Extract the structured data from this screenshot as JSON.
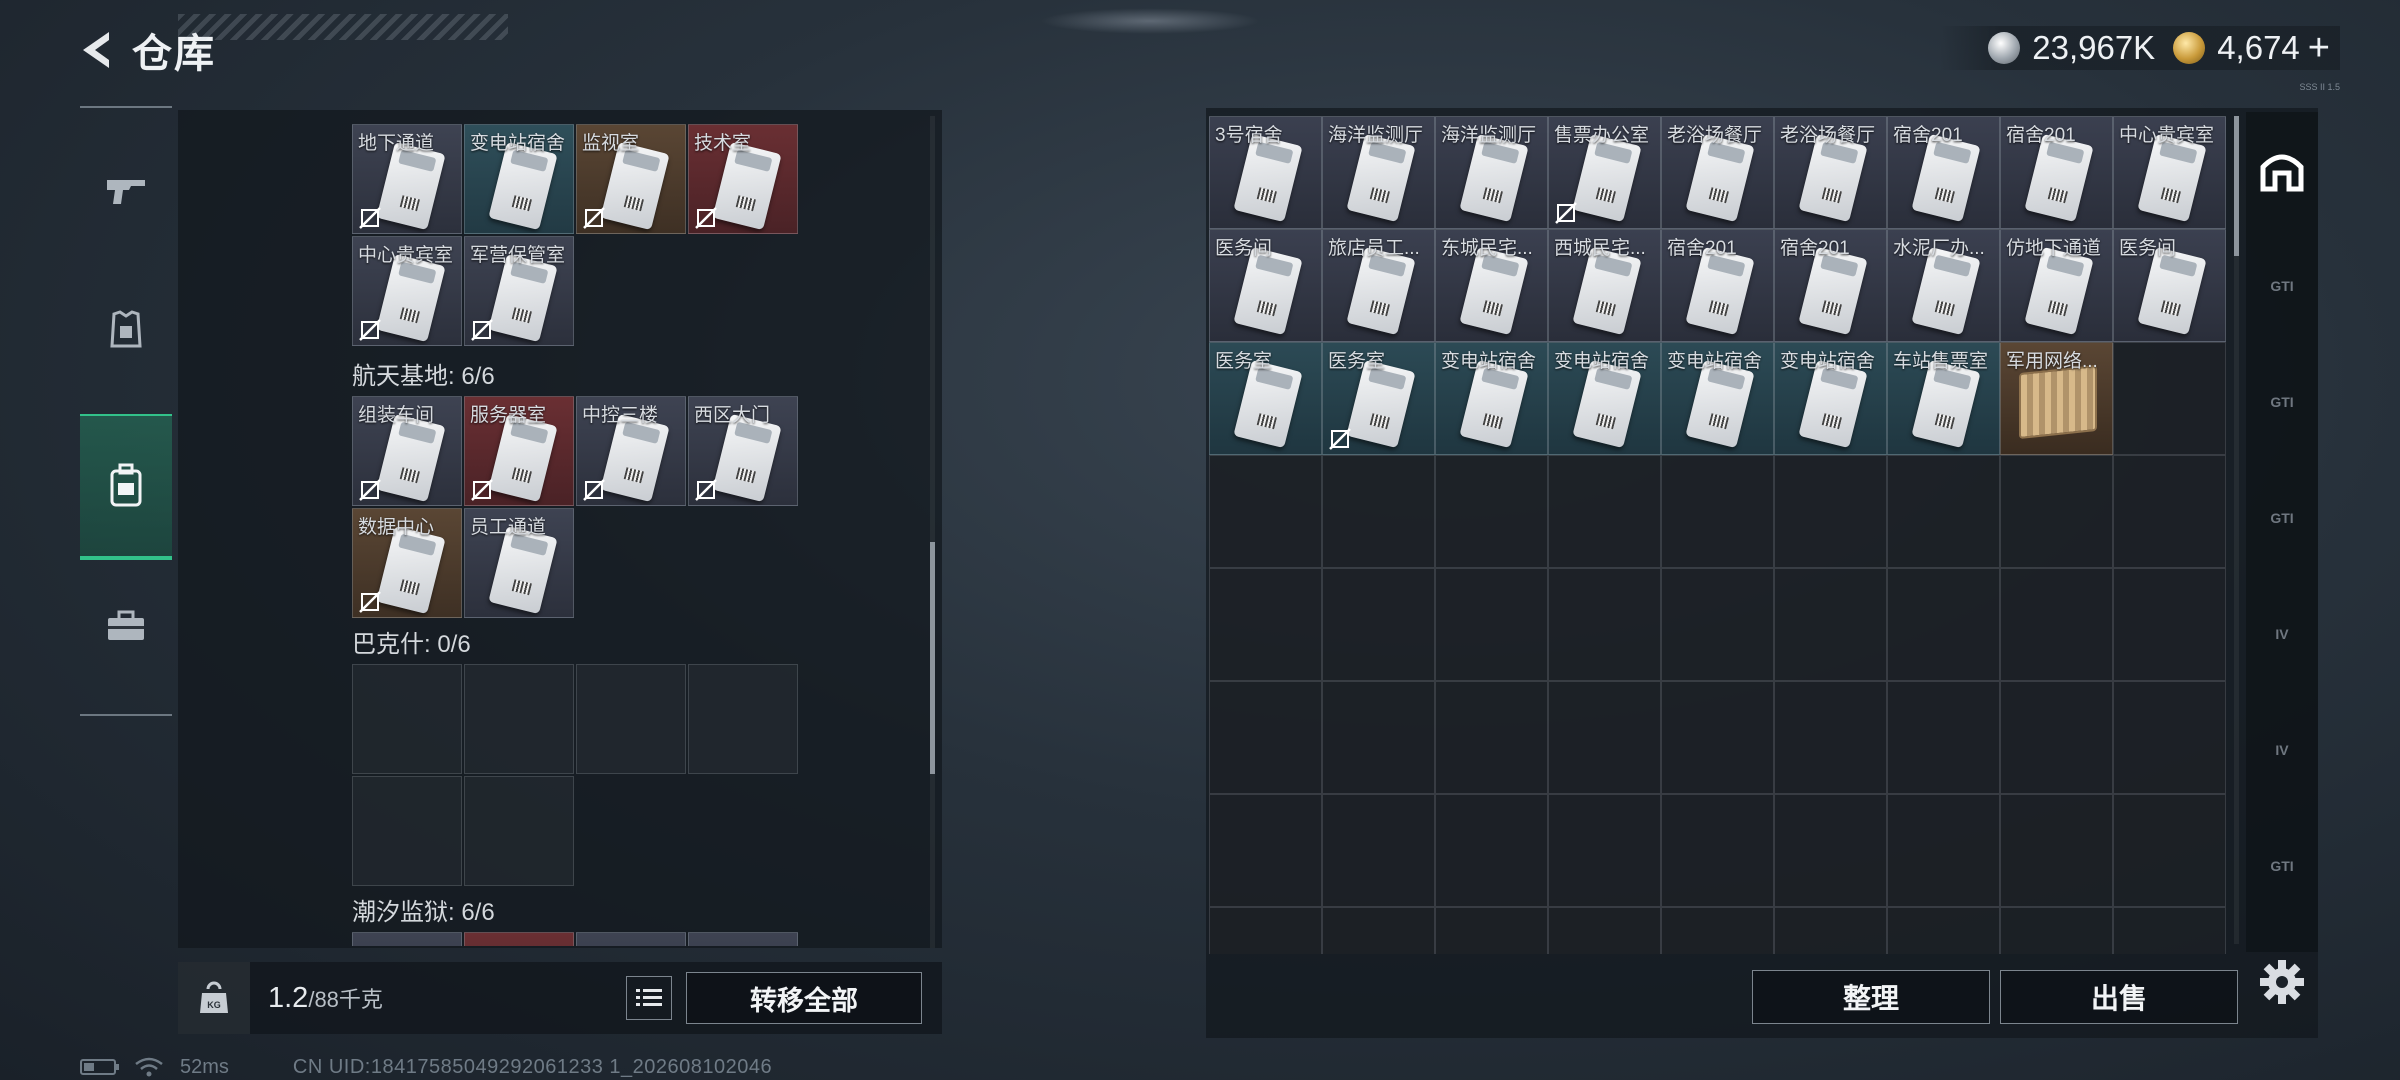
{
  "header": {
    "title": "仓库"
  },
  "currency": {
    "silver": "23,967K",
    "gold": "4,674",
    "plus": "+"
  },
  "tiny_tag": "SSS II 1.5",
  "sidebar": {
    "items": [
      "gun-icon",
      "armor-icon",
      "backpack-icon",
      "toolbox-icon"
    ],
    "active_index": 2
  },
  "left": {
    "groups": [
      {
        "label": "",
        "cells": [
          {
            "name": "地下通道",
            "color": "gray",
            "bound": true
          },
          {
            "name": "变电站宿舍",
            "color": "teal",
            "bound": false
          },
          {
            "name": "监视室",
            "color": "brown",
            "bound": true
          },
          {
            "name": "技术室",
            "color": "red",
            "bound": true
          },
          {
            "name": "中心贵宾室",
            "color": "gray",
            "bound": true
          },
          {
            "name": "军营保管室",
            "color": "gray",
            "bound": true
          }
        ]
      },
      {
        "label": "航天基地: 6/6",
        "cells": [
          {
            "name": "组装车间",
            "color": "gray",
            "bound": true
          },
          {
            "name": "服务器室",
            "color": "red",
            "bound": true
          },
          {
            "name": "中控三楼",
            "color": "gray",
            "bound": true
          },
          {
            "name": "西区大门",
            "color": "gray",
            "bound": true
          },
          {
            "name": "数据中心",
            "color": "brown",
            "bound": true
          },
          {
            "name": "员工通道",
            "color": "gray",
            "bound": false
          }
        ]
      },
      {
        "label": "巴克什: 0/6",
        "cells": []
      },
      {
        "label": "潮汐监狱: 6/6",
        "cells": []
      }
    ],
    "weight_current": "1.2",
    "weight_max": "/88千克",
    "transfer_all": "转移全部"
  },
  "right": {
    "items": [
      {
        "name": "3号宿舍",
        "color": "gray",
        "bound": false,
        "kind": "card"
      },
      {
        "name": "海洋监测厅",
        "color": "gray",
        "bound": false,
        "kind": "card"
      },
      {
        "name": "海洋监测厅",
        "color": "gray",
        "bound": false,
        "kind": "card"
      },
      {
        "name": "售票办公室",
        "color": "gray",
        "bound": true,
        "kind": "card"
      },
      {
        "name": "老浴场餐厅",
        "color": "gray",
        "bound": false,
        "kind": "card"
      },
      {
        "name": "老浴场餐厅",
        "color": "gray",
        "bound": false,
        "kind": "card"
      },
      {
        "name": "宿舍201",
        "color": "gray",
        "bound": false,
        "kind": "card"
      },
      {
        "name": "宿舍201",
        "color": "gray",
        "bound": false,
        "kind": "card"
      },
      {
        "name": "中心贵宾室",
        "color": "gray",
        "bound": false,
        "kind": "card"
      },
      {
        "name": "医务间",
        "color": "gray",
        "bound": false,
        "kind": "card"
      },
      {
        "name": "旅店员工...",
        "color": "gray",
        "bound": false,
        "kind": "card"
      },
      {
        "name": "东城民宅...",
        "color": "gray",
        "bound": false,
        "kind": "card"
      },
      {
        "name": "西城民宅...",
        "color": "gray",
        "bound": false,
        "kind": "card"
      },
      {
        "name": "宿舍201",
        "color": "gray",
        "bound": false,
        "kind": "card"
      },
      {
        "name": "宿舍201",
        "color": "gray",
        "bound": false,
        "kind": "card"
      },
      {
        "name": "水泥厂办...",
        "color": "gray",
        "bound": false,
        "kind": "card"
      },
      {
        "name": "仿地下通道",
        "color": "gray",
        "bound": false,
        "kind": "card"
      },
      {
        "name": "医务间",
        "color": "gray",
        "bound": false,
        "kind": "card"
      },
      {
        "name": "医务室",
        "color": "teal",
        "bound": false,
        "kind": "card"
      },
      {
        "name": "医务室",
        "color": "teal",
        "bound": true,
        "kind": "card"
      },
      {
        "name": "变电站宿舍",
        "color": "teal",
        "bound": false,
        "kind": "card"
      },
      {
        "name": "变电站宿舍",
        "color": "teal",
        "bound": false,
        "kind": "card"
      },
      {
        "name": "变电站宿舍",
        "color": "teal",
        "bound": false,
        "kind": "card"
      },
      {
        "name": "变电站宿舍",
        "color": "teal",
        "bound": false,
        "kind": "card"
      },
      {
        "name": "车站售票室",
        "color": "teal",
        "bound": false,
        "kind": "card"
      },
      {
        "name": "军用网络...",
        "color": "brown2",
        "bound": false,
        "kind": "crate"
      }
    ],
    "tabs": [
      "home-icon",
      "GTI",
      "GTI",
      "GTI",
      "IV",
      "IV",
      "GTI"
    ],
    "active_tab": 0,
    "sort": "整理",
    "sell": "出售"
  },
  "status": {
    "ping": "52ms",
    "uid": "CN UID:18417585049292061233 1_202608102046"
  },
  "colors": {
    "accent": "#32c28a"
  }
}
